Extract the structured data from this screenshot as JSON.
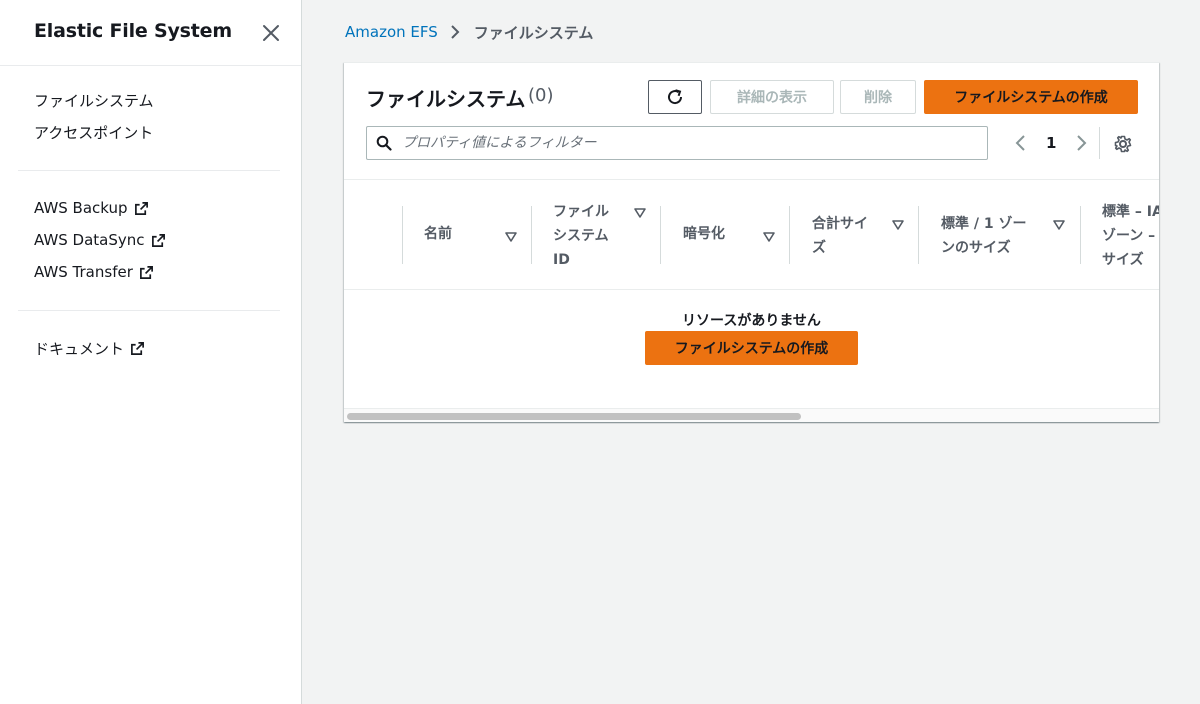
{
  "sidebar": {
    "title": "Elastic File System",
    "primary_items": [
      {
        "label": "ファイルシステム"
      },
      {
        "label": "アクセスポイント"
      }
    ],
    "aws_items": [
      {
        "label": "AWS Backup"
      },
      {
        "label": "AWS DataSync"
      },
      {
        "label": "AWS Transfer"
      }
    ],
    "doc_items": [
      {
        "label": "ドキュメント"
      }
    ]
  },
  "breadcrumb": {
    "root": "Amazon EFS",
    "current": "ファイルシステム"
  },
  "panel": {
    "title": "ファイルシステム",
    "count": "(0)",
    "buttons": {
      "details": "詳細の表示",
      "delete": "削除",
      "create": "ファイルシステムの作成"
    },
    "filter_placeholder": "プロパティ値によるフィルター",
    "page_number": "1",
    "columns": [
      {
        "lines": [
          "名前"
        ]
      },
      {
        "lines": [
          "ファイル",
          "システム",
          "ID"
        ]
      },
      {
        "lines": [
          "暗号化"
        ]
      },
      {
        "lines": [
          "合計サイ",
          "ズ"
        ]
      },
      {
        "lines": [
          "標準 / 1 ゾー",
          "ンのサイズ"
        ]
      },
      {
        "lines": [
          "標準 – IA",
          "ゾーン –",
          "サイズ"
        ]
      }
    ],
    "empty_message": "リソースがありません",
    "empty_create_button": "ファイルシステムの作成"
  },
  "colors": {
    "primary_orange": "#ec7211",
    "link_blue": "#0073bb",
    "page_bg": "#f2f3f3"
  },
  "icons": [
    "close-icon",
    "chevron-right-icon",
    "external-link-icon",
    "refresh-icon",
    "search-icon",
    "chevron-left-icon",
    "settings-icon",
    "sort-down-icon"
  ]
}
